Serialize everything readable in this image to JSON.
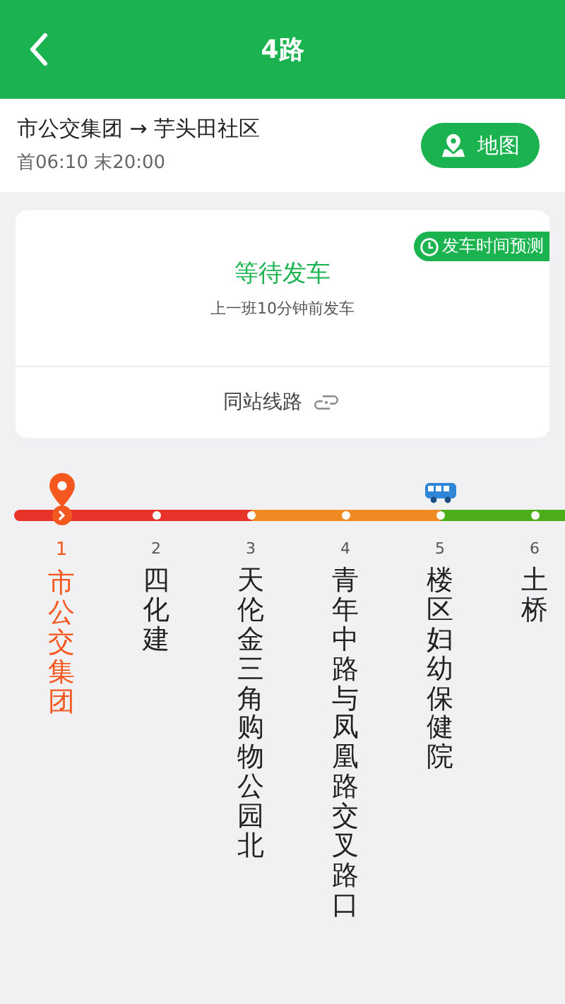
{
  "header": {
    "title": "4路"
  },
  "route": {
    "direction": "市公交集团 → 芋头田社区",
    "hours": "首06:10 末20:00",
    "map_button": "地图"
  },
  "status_card": {
    "badge": "发车时间预测",
    "status": "等待发车",
    "last_departure": "上一班10分钟前发车",
    "same_stop_lines": "同站线路"
  },
  "stations": [
    {
      "number": "1",
      "name": "市公交集团",
      "selected": true,
      "bus": false,
      "color": "#e8332a"
    },
    {
      "number": "2",
      "name": "四化建",
      "selected": false,
      "bus": false,
      "color": "#e8332a"
    },
    {
      "number": "3",
      "name": "天伦金三角购物公园北",
      "selected": false,
      "bus": false,
      "color": "#f08a24"
    },
    {
      "number": "4",
      "name": "青年中路与凤凰路交叉路口",
      "selected": false,
      "bus": false,
      "color": "#f08a24"
    },
    {
      "number": "5",
      "name": "楼区妇幼保健院",
      "selected": false,
      "bus": true,
      "color": "#4caf1a"
    },
    {
      "number": "6",
      "name": "土桥",
      "selected": false,
      "bus": false,
      "color": "#4caf1a"
    }
  ]
}
